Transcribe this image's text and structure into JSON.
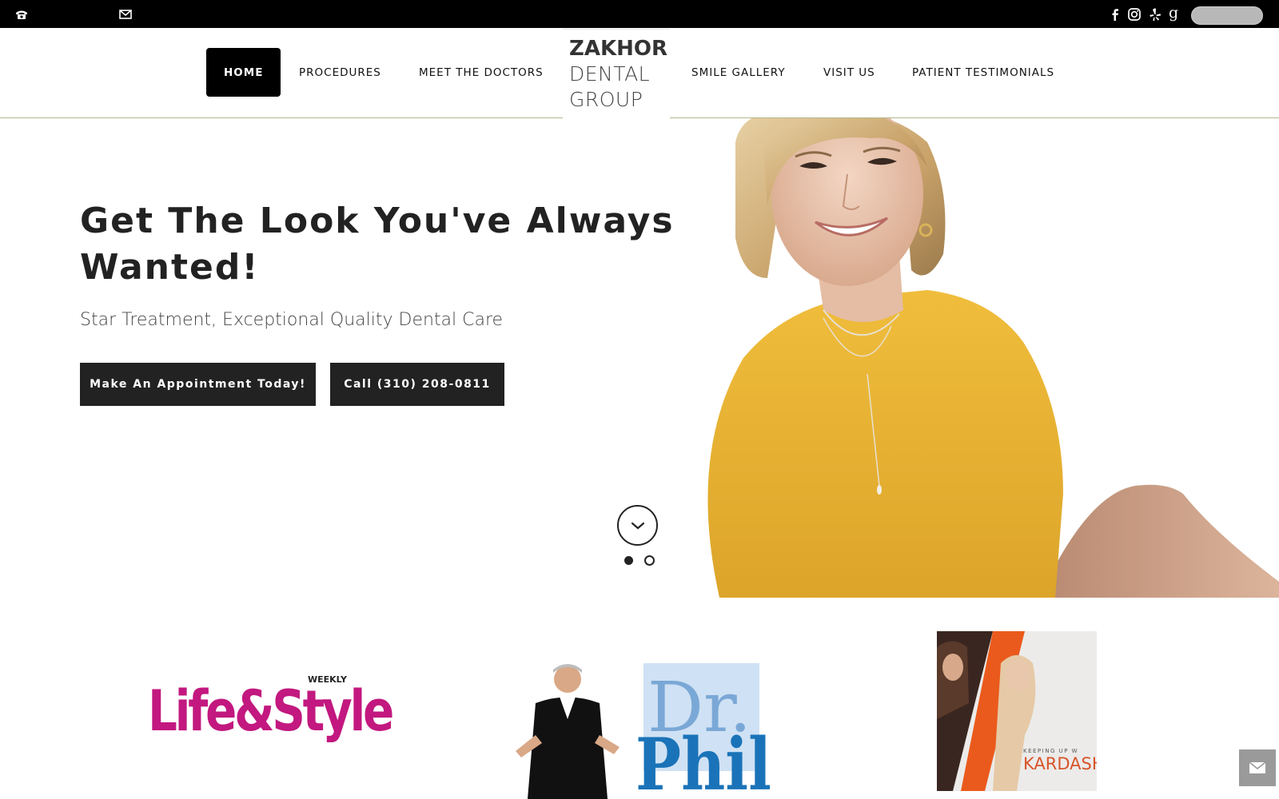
{
  "topbar": {
    "phone_icon": "phone-icon",
    "mail_icon": "mail-icon",
    "social": [
      "facebook-icon",
      "instagram-icon",
      "yelp-icon",
      "google-icon"
    ]
  },
  "nav": {
    "items": [
      {
        "label": "HOME",
        "active": true
      },
      {
        "label": "PROCEDURES",
        "active": false
      },
      {
        "label": "MEET THE DOCTORS",
        "active": false
      },
      {
        "label": "SMILE GALLERY",
        "active": false
      },
      {
        "label": "VISIT US",
        "active": false
      },
      {
        "label": "PATIENT TESTIMONIALS",
        "active": false
      }
    ]
  },
  "logo": {
    "line1": "ZAKHOR",
    "line2": "DENTAL",
    "line3": "GROUP"
  },
  "hero": {
    "title": "Get The Look You've Always Wanted!",
    "subtitle": "Star Treatment, Exceptional Quality Dental Care",
    "btn_appointment": "Make An Appointment Today!",
    "btn_call": "Call (310) 208-0811",
    "slides_total": 2,
    "slide_active": 1
  },
  "press": {
    "lifestyle": {
      "main": "Life&Style",
      "tag": "WEEKLY"
    },
    "drphil": {
      "line1": "Dr.",
      "line2": "Phil"
    },
    "kardashians": {
      "tag": "KEEPING UP W",
      "name": "KARDASH"
    }
  },
  "colors": {
    "nav_active_bg": "#000000",
    "button_bg": "#222222",
    "lifestyle_pink": "#c2187f",
    "drphil_blue": "#1a73b8",
    "sweater_yellow": "#e8b233"
  }
}
